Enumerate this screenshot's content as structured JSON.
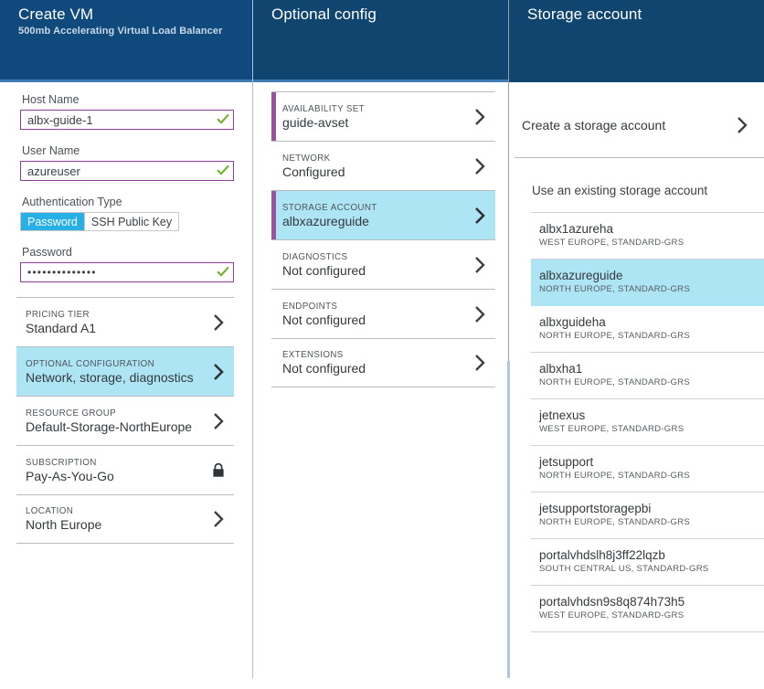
{
  "blades": {
    "create_vm": {
      "title": "Create VM",
      "subtitle": "500mb Accelerating Virtual Load Balancer",
      "fields": {
        "host_name": {
          "label": "Host Name",
          "value": "albx-guide-1",
          "placeholder": "Host Name",
          "valid_icon": "check-icon"
        },
        "user_name": {
          "label": "User Name",
          "value": "azureuser",
          "placeholder": "User Name",
          "valid_icon": "check-icon"
        },
        "auth_type": {
          "label": "Authentication Type",
          "options": [
            "Password",
            "SSH Public Key"
          ],
          "selected": "Password"
        },
        "password": {
          "label": "Password",
          "value": "••••••••••••••",
          "placeholder": "Password",
          "valid_icon": "check-icon"
        }
      },
      "rows": [
        {
          "label": "PRICING TIER",
          "value": "Standard A1",
          "icon": "chevron-right-icon",
          "selected": false
        },
        {
          "label": "OPTIONAL CONFIGURATION",
          "value": "Network, storage, diagnostics",
          "icon": "chevron-right-icon",
          "selected": true
        },
        {
          "label": "RESOURCE GROUP",
          "value": "Default-Storage-NorthEurope",
          "icon": "chevron-right-icon",
          "selected": false
        },
        {
          "label": "SUBSCRIPTION",
          "value": "Pay-As-You-Go",
          "icon": "lock-icon",
          "selected": false
        },
        {
          "label": "LOCATION",
          "value": "North Europe",
          "icon": "chevron-right-icon",
          "selected": false
        }
      ]
    },
    "optional_config": {
      "title": "Optional config",
      "rows": [
        {
          "label": "AVAILABILITY SET",
          "value": "guide-avset",
          "icon": "chevron-right-icon",
          "selected": false,
          "accent": true
        },
        {
          "label": "NETWORK",
          "value": "Configured",
          "icon": "chevron-right-icon",
          "selected": false,
          "accent": false
        },
        {
          "label": "STORAGE ACCOUNT",
          "value": "albxazureguide",
          "icon": "chevron-right-icon",
          "selected": true,
          "accent": true
        },
        {
          "label": "DIAGNOSTICS",
          "value": "Not configured",
          "icon": "chevron-right-icon",
          "selected": false,
          "accent": false
        },
        {
          "label": "ENDPOINTS",
          "value": "Not configured",
          "icon": "chevron-right-icon",
          "selected": false,
          "accent": false
        },
        {
          "label": "EXTENSIONS",
          "value": "Not configured",
          "icon": "chevron-right-icon",
          "selected": false,
          "accent": false
        }
      ]
    },
    "storage_account": {
      "title": "Storage account",
      "create_label": "Create a storage account",
      "create_icon": "chevron-right-icon",
      "existing_title": "Use an existing storage account",
      "accounts": [
        {
          "name": "albx1azureha",
          "meta": "WEST EUROPE, STANDARD-GRS",
          "selected": false
        },
        {
          "name": "albxazureguide",
          "meta": "NORTH EUROPE, STANDARD-GRS",
          "selected": true
        },
        {
          "name": "albxguideha",
          "meta": "NORTH EUROPE, STANDARD-GRS",
          "selected": false
        },
        {
          "name": "albxha1",
          "meta": "NORTH EUROPE, STANDARD-GRS",
          "selected": false
        },
        {
          "name": "jetnexus",
          "meta": "WEST EUROPE, STANDARD-GRS",
          "selected": false
        },
        {
          "name": "jetsupport",
          "meta": "NORTH EUROPE, STANDARD-GRS",
          "selected": false
        },
        {
          "name": "jetsupportstoragepbi",
          "meta": "NORTH EUROPE, STANDARD-GRS",
          "selected": false
        },
        {
          "name": "portalvhdslh8j3ff22lqzb",
          "meta": "SOUTH CENTRAL US, STANDARD-GRS",
          "selected": false
        },
        {
          "name": "portalvhdsn9s8q874h73h5",
          "meta": "WEST EUROPE, STANDARD-GRS",
          "selected": false
        }
      ]
    }
  },
  "colors": {
    "header_blue": "#10456f",
    "selection_cyan": "#aee5f5",
    "accent_purple": "#9c539f",
    "input_border_purple": "#8e3f9e",
    "valid_green": "#6bb023",
    "toggle_active_cyan": "#27b0e6"
  }
}
